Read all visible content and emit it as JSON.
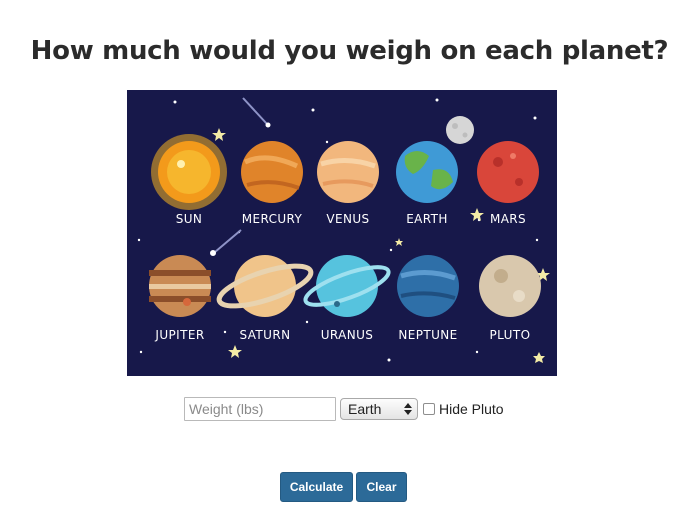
{
  "page": {
    "title": "How much would you weigh on each planet?"
  },
  "image": {
    "background": "#17184a",
    "planets": [
      {
        "label": "SUN",
        "color": "#f39a1b"
      },
      {
        "label": "MERCURY",
        "color": "#e0842a"
      },
      {
        "label": "VENUS",
        "color": "#f2b77d"
      },
      {
        "label": "EARTH",
        "color": "#3f9ad6"
      },
      {
        "label": "MARS",
        "color": "#d9463a"
      },
      {
        "label": "JUPITER",
        "color": "#c98a54"
      },
      {
        "label": "SATURN",
        "color": "#f0c48a"
      },
      {
        "label": "URANUS",
        "color": "#56c3de"
      },
      {
        "label": "NEPTUNE",
        "color": "#2e6fa8"
      },
      {
        "label": "PLUTO",
        "color": "#d9c8ad"
      }
    ]
  },
  "form": {
    "weight_placeholder": "Weight (lbs)",
    "weight_value": "",
    "planet_selected": "Earth",
    "hide_pluto_label": "Hide Pluto",
    "hide_pluto_checked": false
  },
  "buttons": {
    "calculate": "Calculate",
    "clear": "Clear"
  },
  "colors": {
    "button": "#2c6a98",
    "text": "#2b2b2b"
  }
}
